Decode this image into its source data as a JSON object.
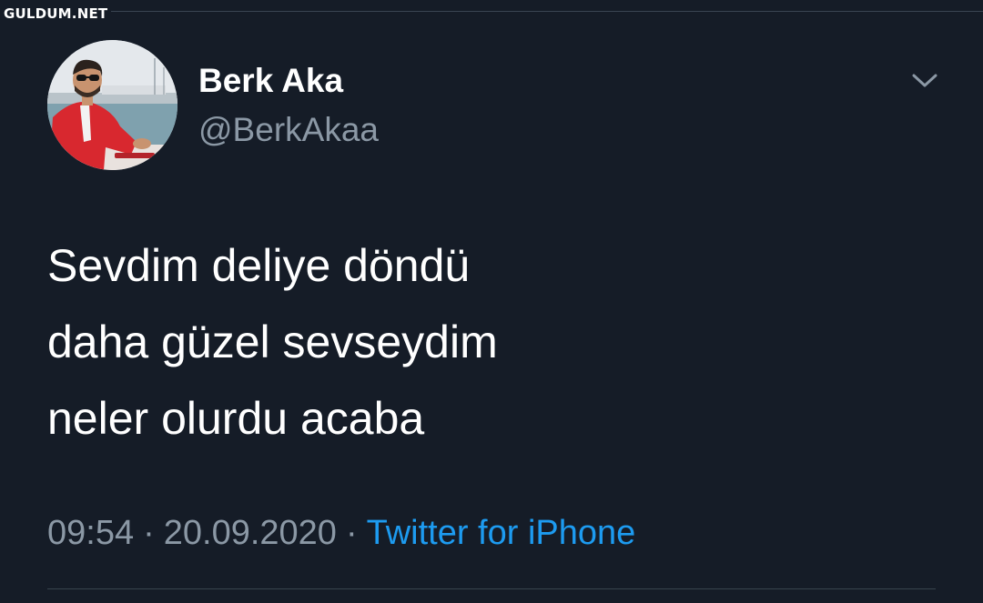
{
  "watermark": "GULDUM.NET",
  "tweet": {
    "display_name": "Berk Aka",
    "handle": "@BerkAkaa",
    "lines": [
      "Sevdim deliye döndü",
      "daha güzel sevseydim",
      "neler olurdu acaba"
    ],
    "time": "09:54",
    "date": "20.09.2020",
    "separator": "·",
    "source": "Twitter for iPhone"
  },
  "icons": {
    "menu": "chevron-down-icon",
    "avatar": "profile-photo"
  },
  "colors": {
    "background": "#151c27",
    "text": "#ffffff",
    "muted": "#8b98a5",
    "link": "#1d9bf0"
  }
}
